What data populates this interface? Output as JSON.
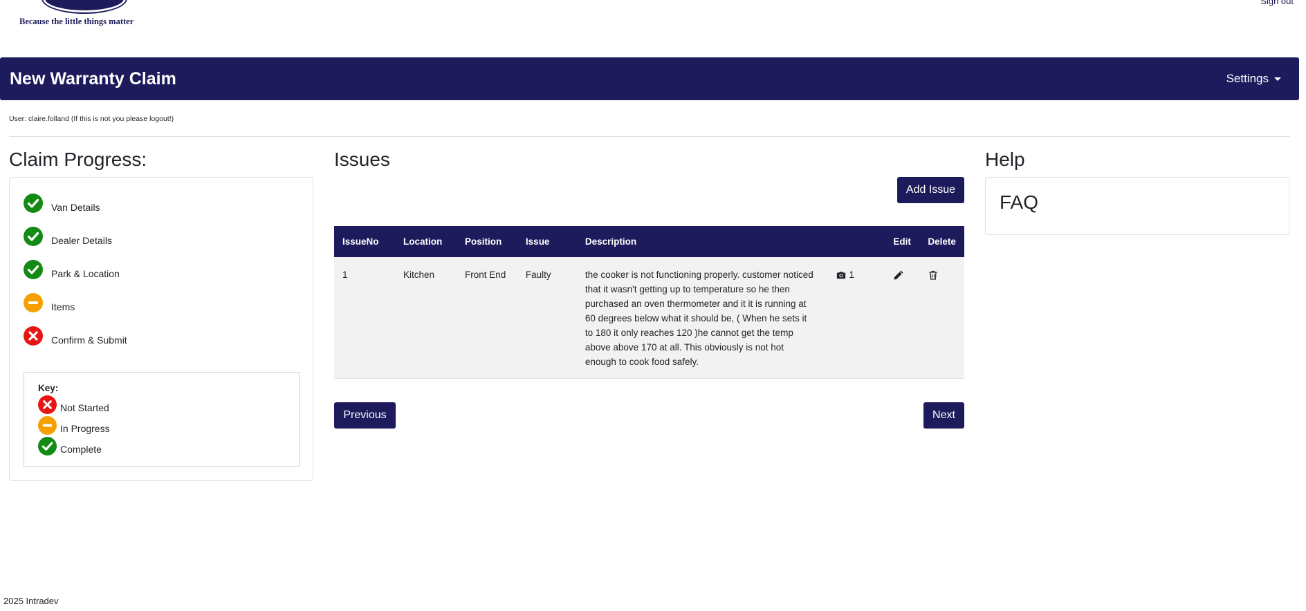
{
  "header": {
    "tagline": "Because the little things matter",
    "signout_label": "Sign out"
  },
  "navbar": {
    "title": "New Warranty Claim",
    "settings_label": "Settings"
  },
  "user_line": "User: claire.folland (If this is not you please logout!)",
  "progress": {
    "title": "Claim Progress:",
    "items": [
      {
        "label": "Van Details",
        "status": "complete"
      },
      {
        "label": "Dealer Details",
        "status": "complete"
      },
      {
        "label": "Park & Location",
        "status": "complete"
      },
      {
        "label": "Items",
        "status": "in-progress"
      },
      {
        "label": "Confirm & Submit",
        "status": "not-started"
      }
    ],
    "key": {
      "title": "Key:",
      "not_started": "Not Started",
      "in_progress": "In Progress",
      "complete": "Complete"
    }
  },
  "issues": {
    "title": "Issues",
    "add_label": "Add Issue",
    "columns": [
      "IssueNo",
      "Location",
      "Position",
      "Issue",
      "Description",
      "",
      "Edit",
      "Delete"
    ],
    "rows": [
      {
        "issue_no": "1",
        "location": "Kitchen",
        "position": "Front End",
        "issue": "Faulty",
        "description": "the cooker is not functioning properly. customer noticed that it wasn't getting up to temperature so he then purchased an oven thermometer and it it is running at 60 degrees below what it should be, ( When he sets it to 180 it only reaches 120 )he cannot get the temp above above 170 at all. This obviously is not hot enough to cook food safely.",
        "photo_count": "1"
      }
    ],
    "previous_label": "Previous",
    "next_label": "Next"
  },
  "help": {
    "title": "Help",
    "faq_label": "FAQ"
  },
  "footer": "2025 Intradev",
  "colors": {
    "brand": "#1e1b5c",
    "complete": "#138a13",
    "in_progress": "#f5a000",
    "not_started": "#e81515"
  },
  "icons": {
    "complete": "check-circle-icon",
    "in_progress": "minus-circle-icon",
    "not_started": "x-circle-icon",
    "photo": "camera-icon",
    "edit": "pencil-icon",
    "delete": "trash-icon"
  }
}
